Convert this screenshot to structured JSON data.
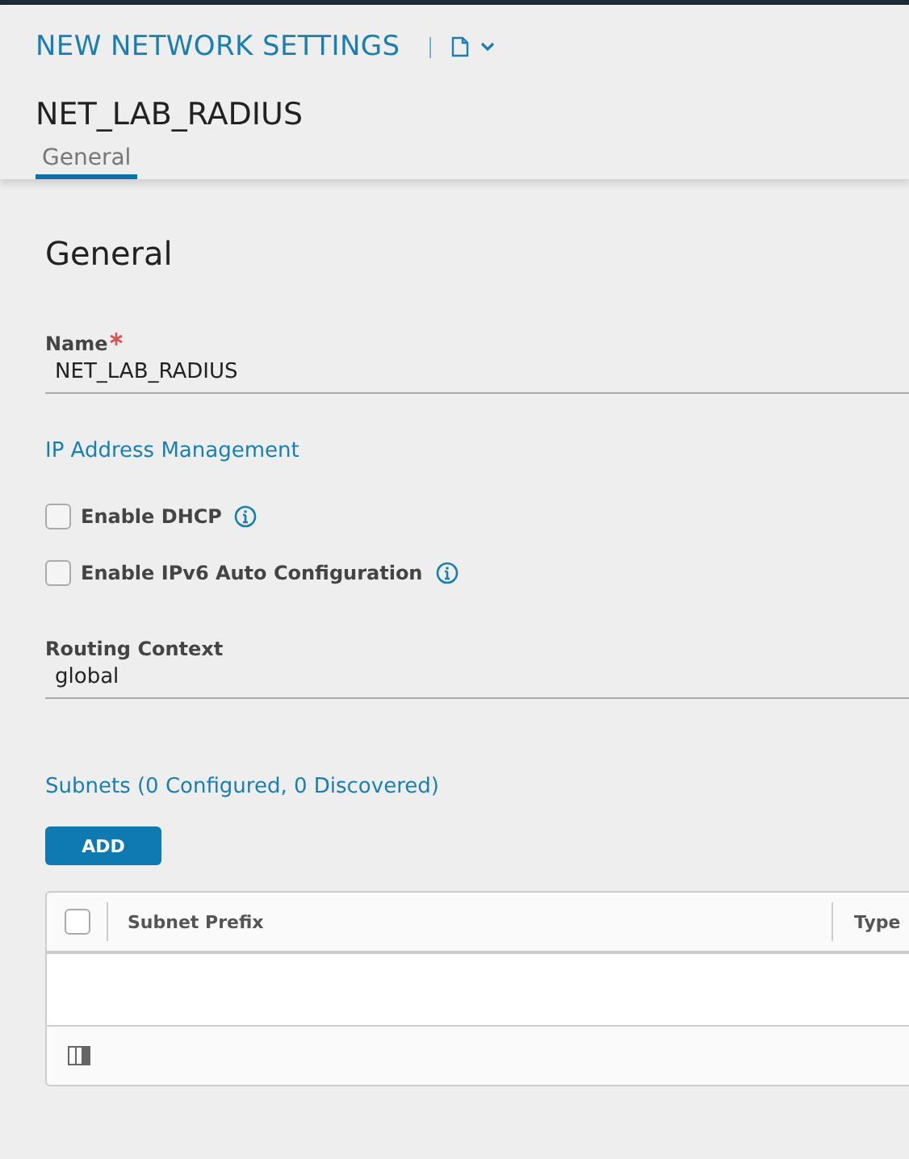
{
  "header": {
    "title": "NEW NETWORK SETTINGS",
    "object_name": "NET_LAB_RADIUS"
  },
  "tabs": [
    {
      "label": "General",
      "selected": true
    }
  ],
  "section_title": "General",
  "name_field": {
    "label": "Name",
    "required": true,
    "value": "NET_LAB_RADIUS"
  },
  "ip_section": "IP Address Management",
  "options": [
    {
      "label": "Enable DHCP",
      "checked": false
    },
    {
      "label": "Enable IPv6 Auto Configuration",
      "checked": false
    }
  ],
  "routing_field": {
    "label": "Routing Context",
    "value": "global"
  },
  "subnets": {
    "title": "Subnets (0 Configured, 0 Discovered)",
    "add_button": "ADD",
    "select_all": false,
    "columns": [
      "Subnet Prefix",
      "Type"
    ]
  }
}
